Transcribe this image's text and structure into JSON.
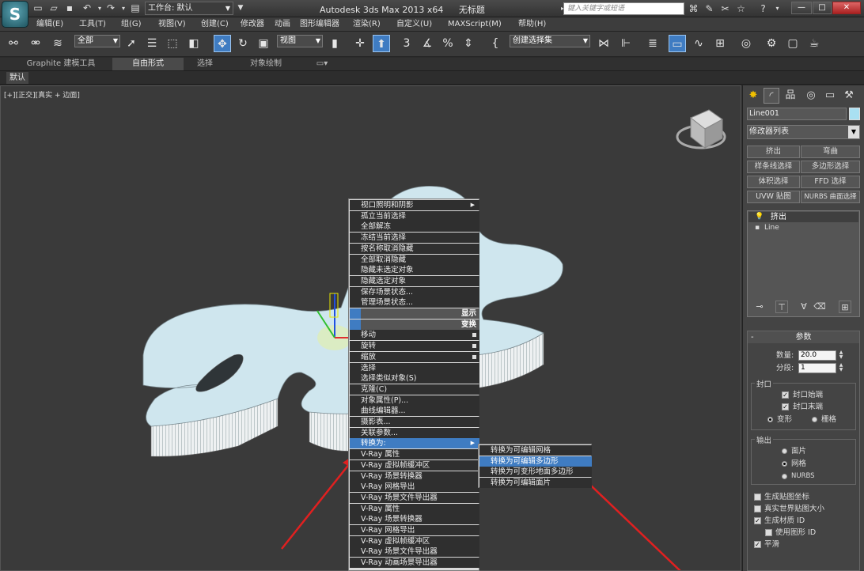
{
  "app": {
    "logo_letter": "S",
    "workspace_label": "工作台: 默认",
    "product": "Autodesk 3ds Max  2013 x64",
    "document": "无标题",
    "search_placeholder": "键入关键字或短语"
  },
  "menu": [
    "编辑(E)",
    "工具(T)",
    "组(G)",
    "视图(V)",
    "创建(C)",
    "修改器",
    "动画",
    "图形编辑器",
    "渲染(R)",
    "自定义(U)",
    "MAXScript(M)",
    "帮助(H)"
  ],
  "toolbar": {
    "selection_filter": "全部",
    "reference_coord": "视图",
    "named_selection_set": "创建选择集",
    "snap_3": "3",
    "snap_2_5": "2.5",
    "percent": "%"
  },
  "ribbon": {
    "tabs": [
      "Graphite 建模工具",
      "自由形式",
      "选择",
      "对象绘制"
    ],
    "active_tab": "自由形式",
    "sub_label": "默认"
  },
  "viewport": {
    "label": "[+][正交][真实 + 边面]",
    "shape_fill": "#cfe6ee",
    "shape_side": "#e9eef0",
    "arrow_color": "#e02020"
  },
  "context_menu": {
    "items": [
      {
        "label": "视口照明和阴影",
        "style": "dark",
        "submenu": true
      },
      {
        "label": "孤立当前选择",
        "style": "dark"
      },
      {
        "label": "全部解冻",
        "style": "dark"
      },
      {
        "label": "冻结当前选择",
        "style": "dark"
      },
      {
        "label": "按名称取消隐藏",
        "style": "dark"
      },
      {
        "label": "全部取消隐藏",
        "style": "dark"
      },
      {
        "label": "隐藏未选定对象",
        "style": "dark"
      },
      {
        "label": "隐藏选定对象",
        "style": "dark"
      },
      {
        "label": "保存场景状态...",
        "style": "dark"
      },
      {
        "label": "管理场景状态...",
        "style": "dark"
      },
      {
        "label": "显示",
        "style": "section"
      },
      {
        "label": "变换",
        "style": "section"
      },
      {
        "label": "移动",
        "style": "dark",
        "box": true
      },
      {
        "label": "旋转",
        "style": "dark",
        "box": true
      },
      {
        "label": "缩放",
        "style": "dark",
        "box": true
      },
      {
        "label": "选择",
        "style": "dark"
      },
      {
        "label": "选择类似对象(S)",
        "style": "dark"
      },
      {
        "label": "克隆(C)",
        "style": "dark"
      },
      {
        "label": "对象属性(P)...",
        "style": "dark"
      },
      {
        "label": "曲线编辑器...",
        "style": "dark"
      },
      {
        "label": "摄影表...",
        "style": "dark"
      },
      {
        "label": "关联参数...",
        "style": "dark"
      },
      {
        "label": "转换为:",
        "style": "highlight",
        "submenu": true
      },
      {
        "label": "V-Ray 属性",
        "style": "dark"
      },
      {
        "label": "V-Ray 虚拟帧缓冲区",
        "style": "dark"
      },
      {
        "label": "V-Ray 场景转换器",
        "style": "dark"
      },
      {
        "label": "V-Ray 网格导出",
        "style": "dark"
      },
      {
        "label": "V-Ray 场景文件导出器",
        "style": "dark"
      },
      {
        "label": "V-Ray 属性",
        "style": "dark"
      },
      {
        "label": "V-Ray 场景转换器",
        "style": "dark"
      },
      {
        "label": "V-Ray 网格导出",
        "style": "dark"
      },
      {
        "label": "V-Ray 虚拟帧缓冲区",
        "style": "dark"
      },
      {
        "label": "V-Ray 场景文件导出器",
        "style": "dark"
      },
      {
        "label": "V-Ray 动画场景导出器",
        "style": "dark"
      }
    ],
    "submenu": [
      {
        "label": "转换为可编辑网格",
        "style": "dark"
      },
      {
        "label": "转换为可编辑多边形",
        "style": "highlight"
      },
      {
        "label": "转换为可变形地面多边形",
        "style": "dark"
      },
      {
        "label": "转换为可编辑面片",
        "style": "dark"
      }
    ]
  },
  "command_panel": {
    "object_name": "Line001",
    "object_color": "#a9e0f2",
    "modifier_list": "修改器列表",
    "modifier_buttons": [
      "挤出",
      "弯曲",
      "样条线选择",
      "多边形选择",
      "体积选择",
      "FFD 选择",
      "UVW 贴图",
      "NURBS 曲面选择"
    ],
    "stack": {
      "extrude": "挤出",
      "line": "Line"
    },
    "params": {
      "title": "参数",
      "amount_label": "数量:",
      "amount_value": "20.0",
      "segments_label": "分段:",
      "segments_value": "1",
      "capping_title": "封口",
      "cap_start": "封口始端",
      "cap_end": "封口末端",
      "morph": "变形",
      "grid": "栅格",
      "output_title": "输出",
      "patch": "面片",
      "mesh": "网格",
      "nurbs": "NURBS",
      "gen_map_coords": "生成贴图坐标",
      "real_world": "真实世界贴图大小",
      "gen_mat_ids": "生成材质 ID",
      "use_shape_ids": "使用图形 ID",
      "smooth": "平滑"
    }
  }
}
